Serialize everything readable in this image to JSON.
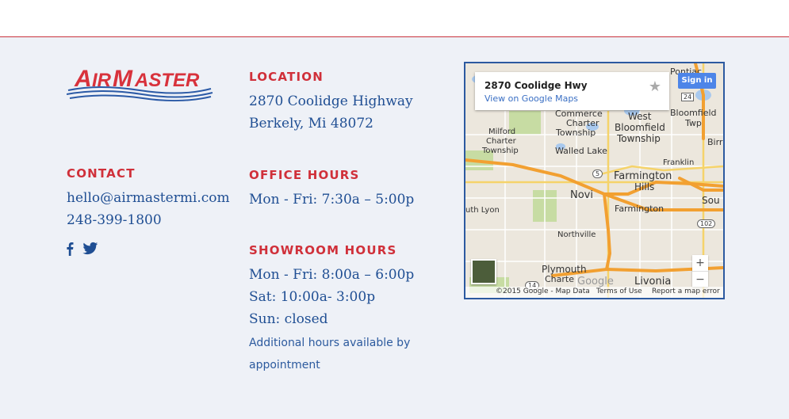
{
  "brand": {
    "logo_text": "AIRMASTER",
    "logo_alt": "AirMaster"
  },
  "location": {
    "heading": "LOCATION",
    "line1": "2870 Coolidge Highway",
    "line2": "Berkely, Mi 48072"
  },
  "contact": {
    "heading": "CONTACT",
    "email": "hello@airmastermi.com",
    "phone": "248-399-1800",
    "social": [
      {
        "icon": "facebook-icon",
        "label": "f"
      },
      {
        "icon": "twitter-icon",
        "label": "twitter"
      }
    ]
  },
  "office_hours": {
    "heading": "OFFICE HOURS",
    "line1": "Mon - Fri: 7:30a – 5:00p"
  },
  "showroom_hours": {
    "heading": "SHOWROOM HOURS",
    "line1": "Mon - Fri: 8:00a – 6:00p",
    "line2": "Sat: 10:00a- 3:00p",
    "line3": "Sun: closed",
    "note_line1": "Additional hours available by",
    "note_line2": "appointment"
  },
  "map": {
    "place_name": "2870 Coolidge Hwy",
    "view_link": "View on Google Maps",
    "sign_in": "Sign in",
    "zoom_in": "+",
    "zoom_out": "−",
    "copyright": "©2015 Google - Map Data",
    "terms": "Terms of Use",
    "report": "Report a map error",
    "watermark": "Google",
    "labels": {
      "pontiac": "Pontiac",
      "west_bloomfield": "West",
      "west_bloomfield2": "Bloomfield",
      "west_bloomfield3": "Township",
      "bloomfield": "Bloomfield",
      "bloomfield2": "Twp",
      "commerce": "Commerce",
      "charter": "Charter",
      "township": "Township",
      "milford": "Milford",
      "milford2": "Charter",
      "milford3": "Township",
      "walled_lake": "Walled Lake",
      "franklin": "Franklin",
      "farmington_hills": "Farmington",
      "farmington_hills2": "Hills",
      "novi": "Novi",
      "farmington": "Farmington",
      "south_lyon": "uth Lyon",
      "northville": "Northville",
      "plymouth": "Plymouth",
      "plymouth2": "Charte",
      "livonia": "Livonia",
      "birm": "Birr",
      "sou": "Sou",
      "r24": "24",
      "r5": "5",
      "r102": "102",
      "r14": "14"
    },
    "colors": {
      "highway": "#f2a031",
      "water": "#a9c9ee",
      "park": "#c7dca3",
      "road": "#ffffff"
    }
  },
  "colors": {
    "accent": "#d0303a",
    "text": "#1f4e93",
    "background": "#eef1f7"
  }
}
